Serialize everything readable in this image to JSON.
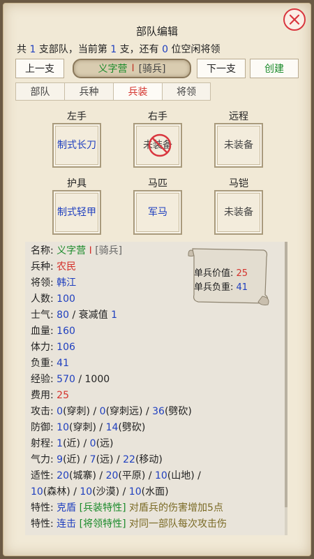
{
  "title": "部队编辑",
  "summary": {
    "prefix": "共",
    "total": "1",
    "mid1": "支部队，当前第",
    "current": "1",
    "mid2": "支，还有",
    "idle": "0",
    "suffix": "位空闲将领"
  },
  "buttons": {
    "prev": "上一支",
    "next": "下一支",
    "create": "创建"
  },
  "unit": {
    "name": "义字营",
    "level": "I",
    "type": "[骑兵]"
  },
  "tabs": [
    {
      "label": "部队"
    },
    {
      "label": "兵种"
    },
    {
      "label": "兵装"
    },
    {
      "label": "将领"
    }
  ],
  "equipment": {
    "left_hand": {
      "label": "左手",
      "value": "制式长刀"
    },
    "right_hand": {
      "label": "右手",
      "value": "未装备"
    },
    "ranged": {
      "label": "远程",
      "value": "未装备"
    },
    "armor": {
      "label": "护具",
      "value": "制式轻甲"
    },
    "horse": {
      "label": "马匹",
      "value": "军马"
    },
    "barding": {
      "label": "马铠",
      "value": "未装备"
    }
  },
  "note": {
    "value_label": "单兵价值:",
    "value": "25",
    "load_label": "单兵负重:",
    "load": "41"
  },
  "stats": {
    "name_label": "名称:",
    "name_value": "义字营",
    "name_level": "I",
    "name_type": "[骑兵]",
    "soldier_label": "兵种:",
    "soldier_value": "农民",
    "general_label": "将领:",
    "general_value": "韩江",
    "count_label": "人数:",
    "count_value": "100",
    "morale_label": "士气:",
    "morale_value": "80",
    "morale_sep": "/ 衰减值",
    "morale_decay": "1",
    "hp_label": "血量:",
    "hp_value": "160",
    "stamina_label": "体力:",
    "stamina_value": "106",
    "load_label": "负重:",
    "load_value": "41",
    "exp_label": "经验:",
    "exp_value": "570",
    "exp_max": "/ 1000",
    "cost_label": "费用:",
    "cost_value": "25",
    "attack_label": "攻击:",
    "attack_1": "0",
    "attack_1_t": "(穿刺)",
    "attack_2": "0",
    "attack_2_t": "(穿刺远)",
    "attack_3": "36",
    "attack_3_t": "(劈砍)",
    "defense_label": "防御:",
    "defense_1": "10",
    "defense_1_t": "(穿刺)",
    "defense_2": "14",
    "defense_2_t": "(劈砍)",
    "range_label": "射程:",
    "range_1": "1",
    "range_1_t": "(近)",
    "range_2": "0",
    "range_2_t": "(远)",
    "qi_label": "气力:",
    "qi_1": "9",
    "qi_1_t": "(近)",
    "qi_2": "7",
    "qi_2_t": "(远)",
    "qi_3": "22",
    "qi_3_t": "(移动)",
    "adapt_label": "适性:",
    "adapt_1": "20",
    "adapt_1_t": "(城寨)",
    "adapt_2": "20",
    "adapt_2_t": "(平原)",
    "adapt_3": "10",
    "adapt_3_t": "(山地)",
    "adapt_4": "10",
    "adapt_4_t": "(森林)",
    "adapt_5": "10",
    "adapt_5_t": "(沙漠)",
    "adapt_6": "10",
    "adapt_6_t": "(水面)",
    "trait1_label": "特性:",
    "trait1_name": "克盾",
    "trait1_src": "[兵装特性]",
    "trait1_desc": "对盾兵的伤害增加5点",
    "trait2_label": "特性:",
    "trait2_name": "连击",
    "trait2_src": "[将领特性]",
    "trait2_desc": "对同一部队每次攻击伤"
  },
  "colors": {
    "value_blue": "#1f3fbf",
    "accent_red": "#d4322c",
    "name_green": "#1a8a2a",
    "panel_bg": "#f1e9d6"
  },
  "icons": {
    "close": "close-icon",
    "forbid": "forbidden-icon"
  }
}
